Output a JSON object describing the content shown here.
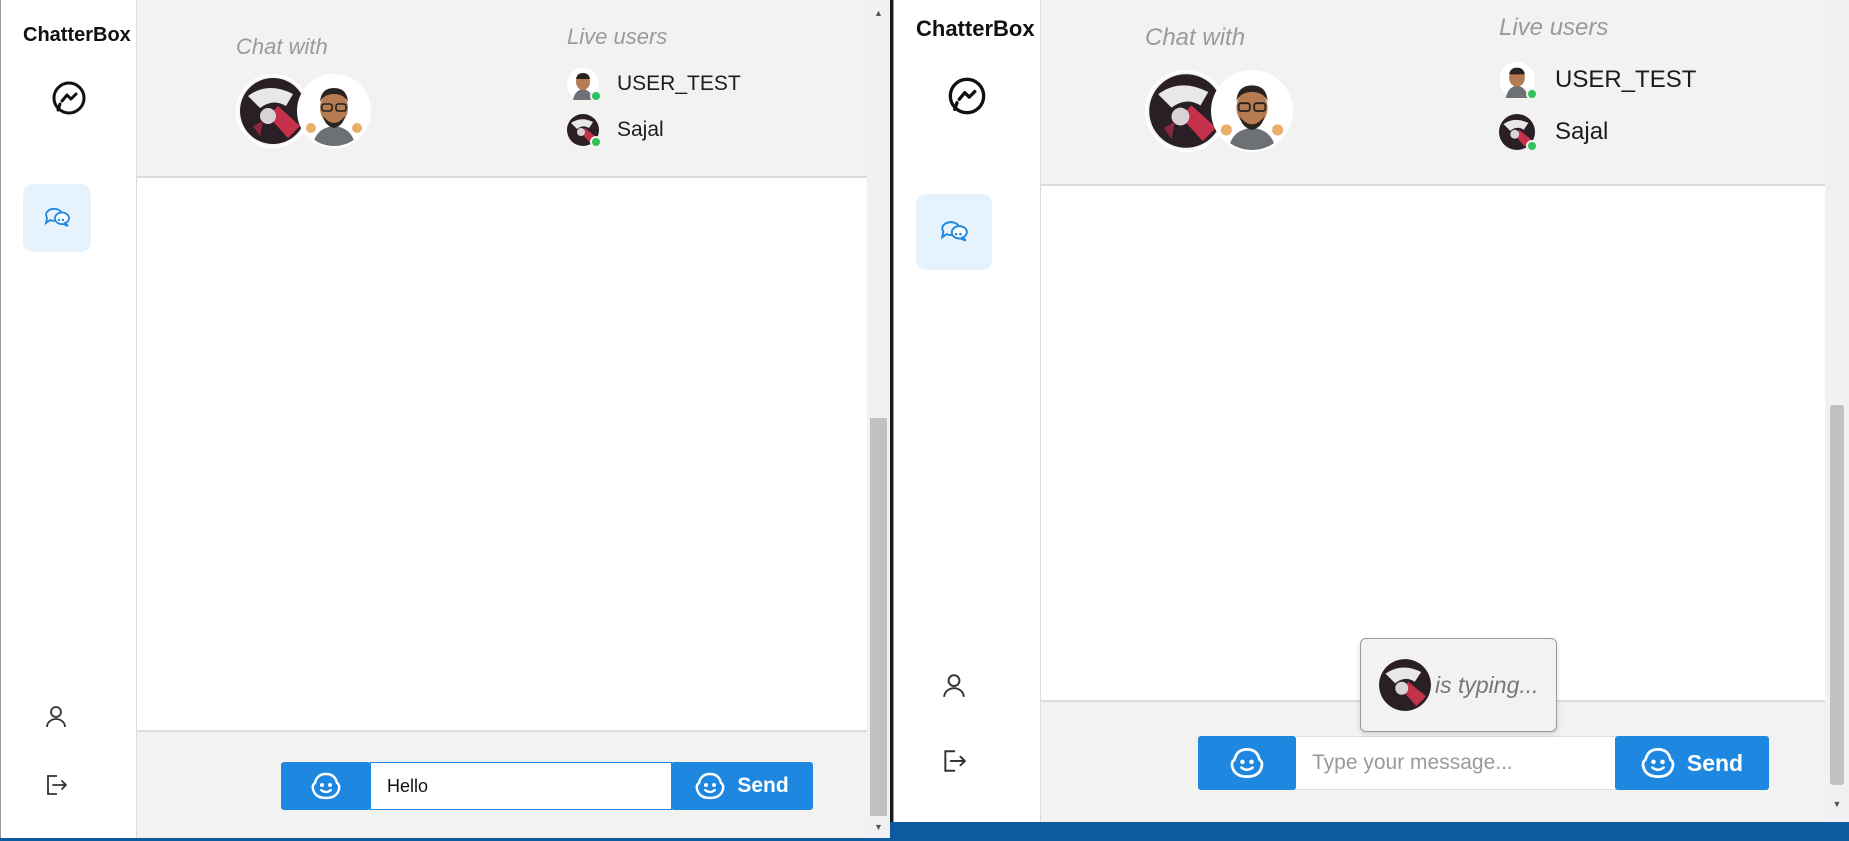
{
  "app": {
    "brand": "ChatterBox"
  },
  "header": {
    "chat_with_label": "Chat with",
    "live_users_label": "Live users",
    "live_users": [
      {
        "name": "USER_TEST",
        "status": "online"
      },
      {
        "name": "Sajal",
        "status": "online"
      }
    ]
  },
  "footer": {
    "send_label": "Send",
    "input_value_left": "Hello",
    "input_placeholder_right": "Type your message..."
  },
  "typing": {
    "text": "is typing..."
  },
  "icons": {
    "messenger": "messenger-icon",
    "chats": "chat-bubbles-icon",
    "user": "user-icon",
    "logout": "logout-icon",
    "emoji": "emoji-icon"
  },
  "colors": {
    "accent": "#1e88e0",
    "online": "#2ec25a",
    "active_bg": "#e6f3fc",
    "header_bg": "#f2f2f1"
  }
}
